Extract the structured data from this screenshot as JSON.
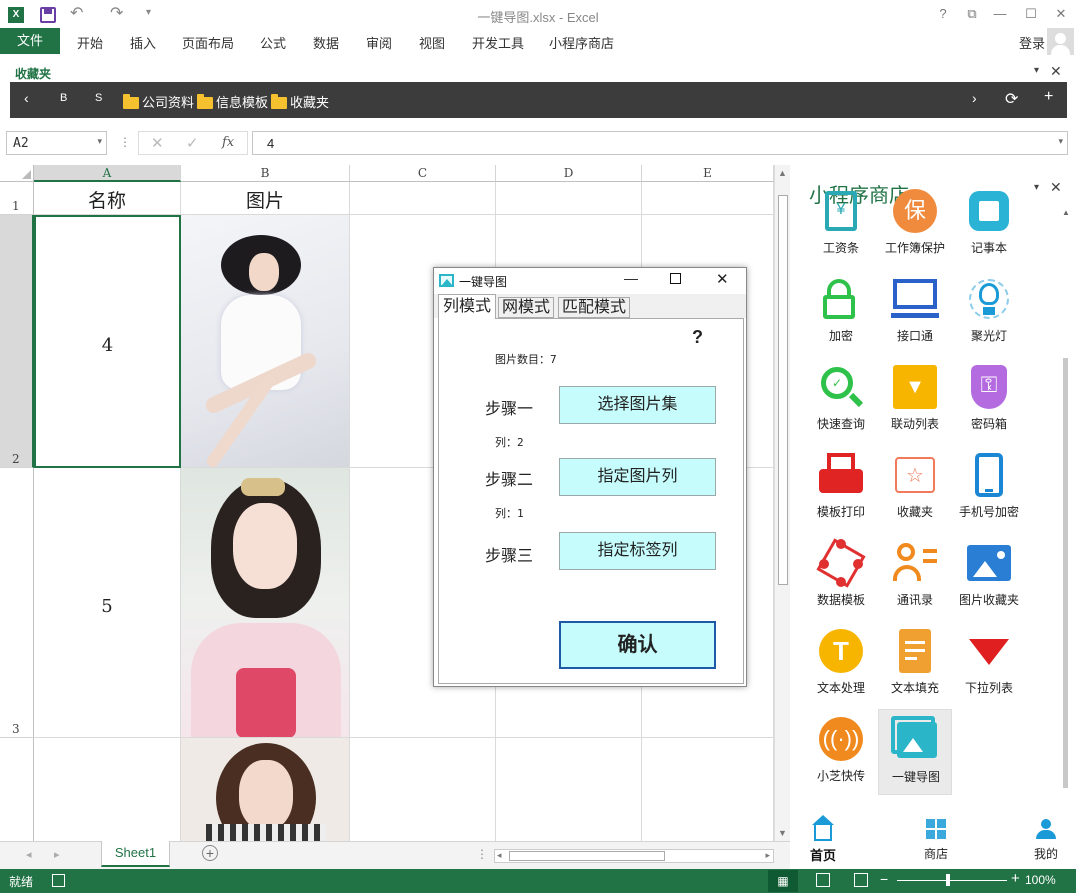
{
  "window": {
    "title": "一键导图.xlsx - Excel",
    "help": "?",
    "buttons": [
      "restore-ribbon",
      "minimize",
      "maximize",
      "close"
    ]
  },
  "ribbon": {
    "file_tab": "文件",
    "tabs": [
      "开始",
      "插入",
      "页面布局",
      "公式",
      "数据",
      "审阅",
      "视图",
      "开发工具",
      "小程序商店"
    ],
    "login": "登录"
  },
  "favorites": {
    "title": "收藏夹",
    "items": [
      "B",
      "S"
    ],
    "folders": [
      "公司资料",
      "信息模板",
      "收藏夹"
    ]
  },
  "formula_bar": {
    "name_box": "A2",
    "fx": "fx",
    "value": "4"
  },
  "sheet": {
    "columns": [
      "A",
      "B",
      "C",
      "D",
      "E"
    ],
    "rows": [
      "1",
      "2",
      "3"
    ],
    "header_cells": [
      "名称",
      "图片"
    ],
    "values": [
      "4",
      "5"
    ],
    "tab_name": "Sheet1"
  },
  "status": {
    "ready": "就绪",
    "zoom": "100%"
  },
  "pane": {
    "title": "小程序商店",
    "apps": [
      {
        "label": "工资条",
        "icon": "payslip-icon",
        "color": "#2aa9b5"
      },
      {
        "label": "工作簿保护",
        "icon": "protect-icon",
        "color": "#f08a3c"
      },
      {
        "label": "记事本",
        "icon": "notepad-icon",
        "color": "#2bb3d6"
      },
      {
        "label": "加密",
        "icon": "lock-icon",
        "color": "#2fc24a"
      },
      {
        "label": "接口通",
        "icon": "monitor-icon",
        "color": "#2a62c9"
      },
      {
        "label": "聚光灯",
        "icon": "bulb-icon",
        "color": "#1a9bd7"
      },
      {
        "label": "快速查询",
        "icon": "search-check-icon",
        "color": "#2fc24a"
      },
      {
        "label": "联动列表",
        "icon": "list-down-icon",
        "color": "#f7b500"
      },
      {
        "label": "密码箱",
        "icon": "key-shield-icon",
        "color": "#b46be0"
      },
      {
        "label": "模板打印",
        "icon": "printer-icon",
        "color": "#e02424"
      },
      {
        "label": "收藏夹",
        "icon": "star-folder-icon",
        "color": "#f07a5a"
      },
      {
        "label": "手机号加密",
        "icon": "phone-icon",
        "color": "#1a86d4"
      },
      {
        "label": "数据模板",
        "icon": "network-icon",
        "color": "#e03030"
      },
      {
        "label": "通讯录",
        "icon": "contact-icon",
        "color": "#f08a1e"
      },
      {
        "label": "图片收藏夹",
        "icon": "picture-icon",
        "color": "#2a7fd4"
      },
      {
        "label": "文本处理",
        "icon": "text-t-icon",
        "color": "#f7b500"
      },
      {
        "label": "文本填充",
        "icon": "doc-fill-icon",
        "color": "#f0a030"
      },
      {
        "label": "下拉列表",
        "icon": "triangle-down-icon",
        "color": "#e02020"
      },
      {
        "label": "小芝快传",
        "icon": "broadcast-icon",
        "color": "#f08a1e"
      },
      {
        "label": "一键导图",
        "icon": "image-export-icon",
        "color": "#2ab5c8"
      }
    ],
    "nav": [
      "首页",
      "商店",
      "我的"
    ]
  },
  "dialog": {
    "title": "一键导图",
    "tabs": [
      "列模式",
      "网模式",
      "匹配模式"
    ],
    "help": "?",
    "count_label": "图片数目：7",
    "step1": "步骤一",
    "step1_btn": "选择图片集",
    "col_label": "列：2",
    "step2": "步骤二",
    "step2_btn": "指定图片列",
    "tag_label": "列：1",
    "step3": "步骤三",
    "step3_btn": "指定标签列",
    "confirm": "确认"
  },
  "colors": {
    "excel_green": "#217346",
    "dialog_button": "#c6fcfc",
    "confirm_border": "#1f5aa8"
  }
}
